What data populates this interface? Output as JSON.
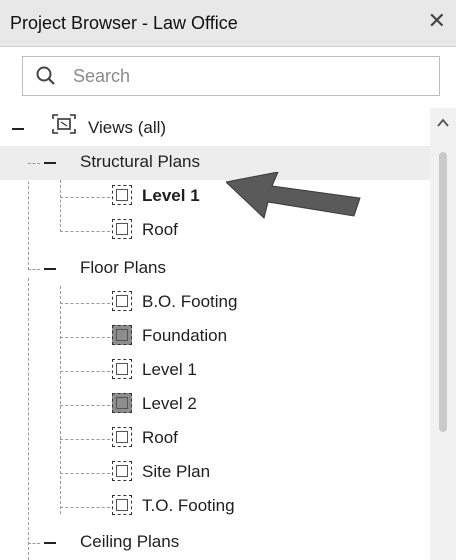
{
  "window": {
    "title": "Project Browser - Law Office",
    "close_glyph": "✕"
  },
  "search": {
    "placeholder": "Search",
    "icon": "search-icon"
  },
  "tree": {
    "root": {
      "label": "Views (all)",
      "toggle": "−",
      "icon": "views-icon"
    },
    "groups": [
      {
        "label": "Structural Plans",
        "items": [
          {
            "label": "Level 1",
            "bold": true,
            "filled": false
          },
          {
            "label": "Roof",
            "bold": false,
            "filled": false
          }
        ]
      },
      {
        "label": "Floor Plans",
        "items": [
          {
            "label": "B.O. Footing",
            "filled": false
          },
          {
            "label": "Foundation",
            "filled": true
          },
          {
            "label": "Level 1",
            "filled": false
          },
          {
            "label": "Level 2",
            "filled": true
          },
          {
            "label": "Roof",
            "filled": false
          },
          {
            "label": "Site Plan",
            "filled": false
          },
          {
            "label": "T.O. Footing",
            "filled": false
          }
        ]
      },
      {
        "label": "Ceiling Plans",
        "items": []
      }
    ]
  },
  "annotation": {
    "icon": "pointer-arrow-icon",
    "color": "#5a5a5a"
  },
  "colors": {
    "selected_row": "#ededed",
    "titlebar": "#e8e8e8",
    "filled_view": "#8d8d8d"
  }
}
